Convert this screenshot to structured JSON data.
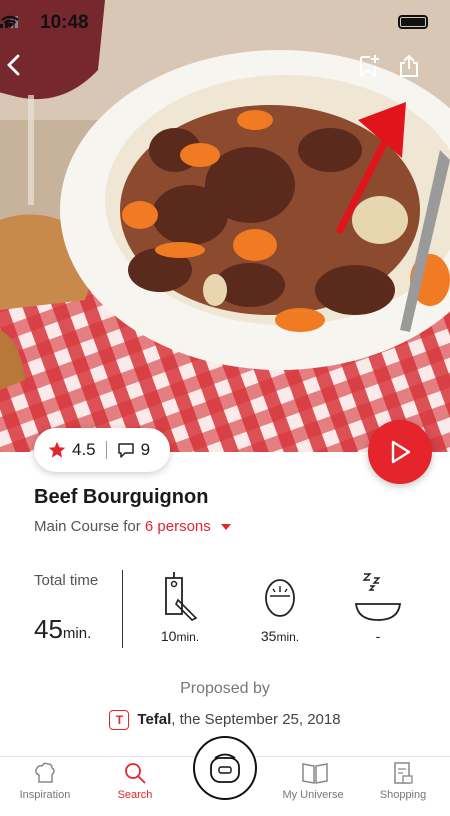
{
  "status_bar": {
    "time": "10:48"
  },
  "recipe": {
    "rating": "4.5",
    "comments": "9",
    "title": "Beef Bourguignon",
    "course_prefix": "Main Course for ",
    "persons": "6 persons"
  },
  "times": {
    "total_label": "Total time",
    "total_value": "45",
    "unit": "min.",
    "prep_value": "10",
    "cook_value": "35",
    "rest_value": "-"
  },
  "proposed": {
    "label": "Proposed by",
    "author": "Tefal",
    "date_text": ", the September 25, 2018",
    "logo_letter": "T"
  },
  "tabs": [
    {
      "label": "Inspiration",
      "icon": "chef-hat-icon"
    },
    {
      "label": "Search",
      "icon": "search-icon"
    },
    {
      "label": "My Universe",
      "icon": "book-icon"
    },
    {
      "label": "Shopping",
      "icon": "shopping-list-icon"
    }
  ],
  "colors": {
    "accent": "#e5242b"
  }
}
